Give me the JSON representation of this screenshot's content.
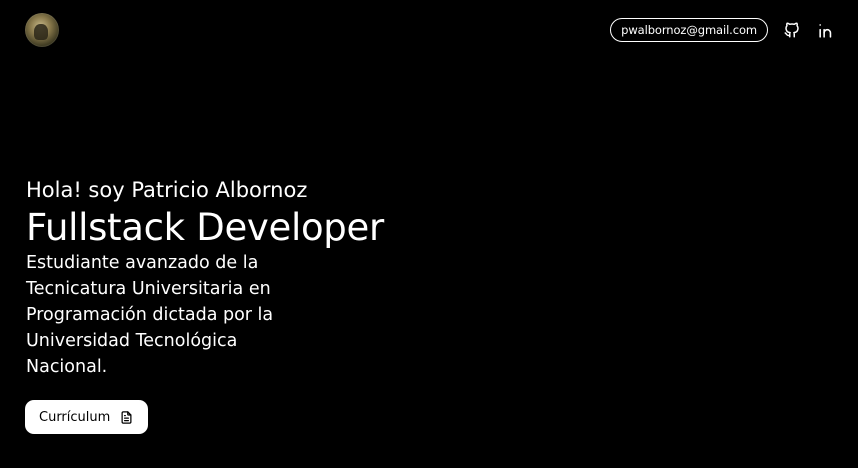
{
  "header": {
    "email": "pwalbornoz@gmail.com",
    "icons": {
      "github": "github-icon",
      "linkedin": "linkedin-icon"
    }
  },
  "hero": {
    "greeting": "Hola! soy Patricio Albornoz",
    "role": "Fullstack Developer",
    "description": "Estudiante avanzado de la Tecnicatura Universitaria en Programación dictada por la Universidad Tecnológica Nacional.",
    "cv_button_label": "Currículum",
    "cv_icon": "document-icon"
  },
  "colors": {
    "background": "#000000",
    "text": "#ffffff",
    "button_bg": "#ffffff",
    "button_text": "#000000"
  }
}
